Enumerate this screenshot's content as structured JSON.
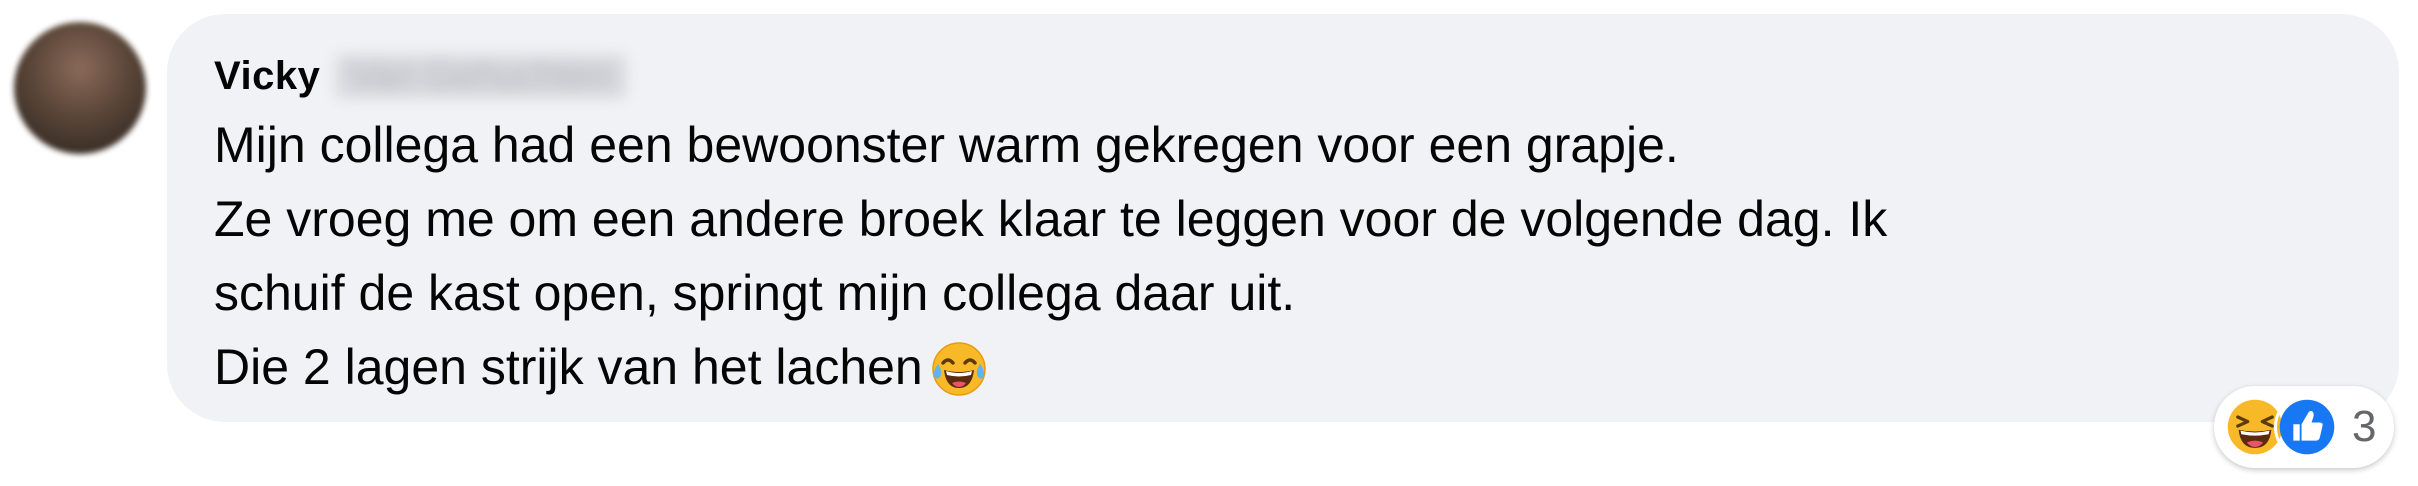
{
  "comment": {
    "author_first_name": "Vicky",
    "author_last_name": "Van Gehuchten",
    "lines": [
      "Mijn collega had een bewoonster warm gekregen voor een grapje.",
      "Ze vroeg me om een andere broek klaar te leggen voor de volgende dag. Ik",
      "schuif de kast open, springt mijn collega daar uit.",
      "Die 2 lagen strijk van het lachen"
    ],
    "inline_emoji": "face-with-tears-of-joy-icon"
  },
  "reactions": {
    "icons": [
      "haha-reaction-icon",
      "like-reaction-icon"
    ],
    "count": "3"
  },
  "colors": {
    "bubble": "#f0f2f5",
    "text": "#050505",
    "secondary_text": "#65676b",
    "like_blue": "#1877f2",
    "haha_yellow": "#f7b928"
  }
}
